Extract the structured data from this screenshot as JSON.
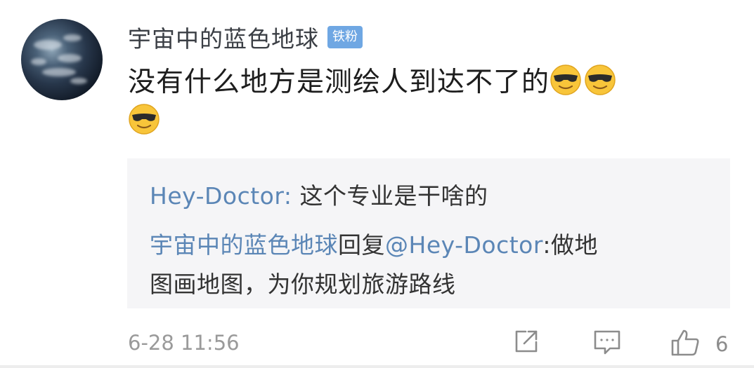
{
  "comment": {
    "username": "宇宙中的蓝色地球",
    "badge": "铁粉",
    "text": "没有什么地方是测绘人到达不了的",
    "emojis": [
      "sunglasses-emoji",
      "sunglasses-emoji",
      "sunglasses-emoji"
    ]
  },
  "replies": {
    "first": {
      "user": "Hey-Doctor:",
      "text": " 这个专业是干啥的"
    },
    "second": {
      "user": "宇宙中的蓝色地球",
      "verb": "回复",
      "mention": "@Hey-Doctor",
      "text_line1": ":做地",
      "text_line2": "图画地图，为你规划旅游路线"
    }
  },
  "footer": {
    "timestamp": "6-28 11:56",
    "like_count": "6",
    "icons": [
      "share-icon",
      "reply-icon",
      "like-icon"
    ]
  },
  "colors": {
    "link_blue": "#5b86b6",
    "badge_blue": "#6fa7e3",
    "reply_bg": "#f5f5f7"
  }
}
